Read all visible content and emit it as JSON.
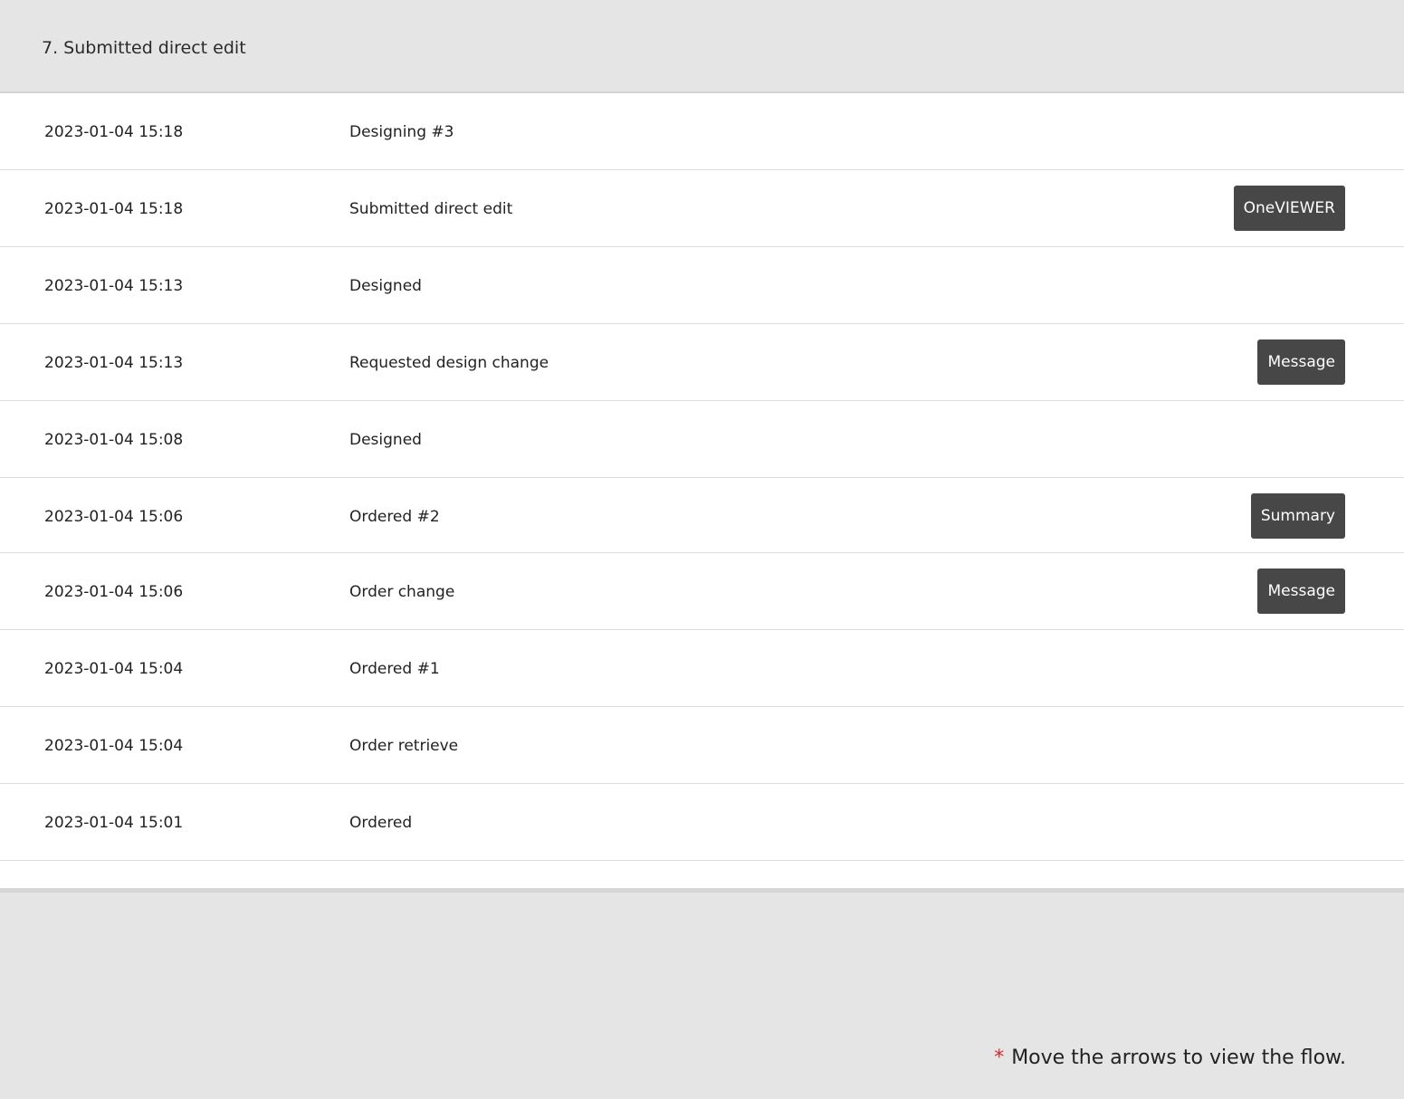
{
  "header": {
    "title": "7. Submitted direct edit"
  },
  "history": {
    "rows": [
      {
        "time": "2023-01-04 15:18",
        "event": "Designing #3",
        "button": null
      },
      {
        "time": "2023-01-04 15:18",
        "event": "Submitted direct edit",
        "button": "OneVIEWER"
      },
      {
        "time": "2023-01-04 15:13",
        "event": "Designed",
        "button": null
      },
      {
        "time": "2023-01-04 15:13",
        "event": "Requested design change",
        "button": "Message"
      },
      {
        "time": "2023-01-04 15:08",
        "event": "Designed",
        "button": null
      },
      {
        "time": "2023-01-04 15:06",
        "event": "Ordered #2",
        "button": "Summary"
      },
      {
        "time": "2023-01-04 15:06",
        "event": "Order change",
        "button": "Message"
      },
      {
        "time": "2023-01-04 15:04",
        "event": "Ordered #1",
        "button": null
      },
      {
        "time": "2023-01-04 15:04",
        "event": "Order retrieve",
        "button": null
      },
      {
        "time": "2023-01-04 15:01",
        "event": "Ordered",
        "button": null
      }
    ]
  },
  "footer": {
    "asterisk": "*",
    "note": "Move the arrows to view the flow."
  },
  "colors": {
    "background": "#e5e5e5",
    "panel": "#ffffff",
    "button": "#474747",
    "asterisk": "#d62b2b"
  }
}
